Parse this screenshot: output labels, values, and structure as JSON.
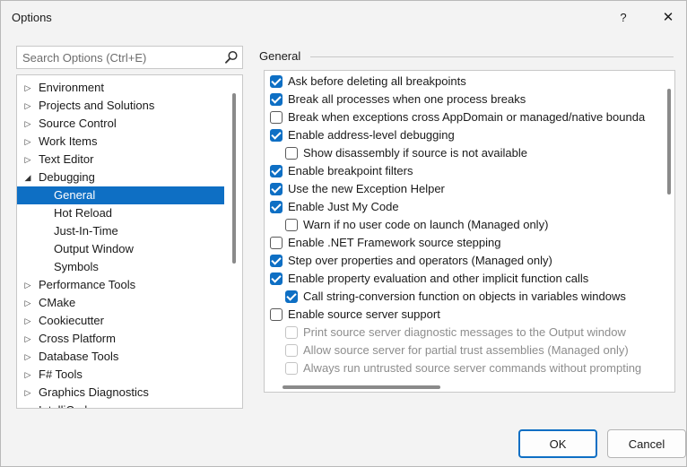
{
  "window": {
    "title": "Options",
    "help_glyph": "?",
    "close_glyph": "✕"
  },
  "search": {
    "placeholder": "Search Options (Ctrl+E)",
    "icon": "search-icon"
  },
  "tree": {
    "items": [
      {
        "label": "Environment",
        "level": 0,
        "expanded": false
      },
      {
        "label": "Projects and Solutions",
        "level": 0,
        "expanded": false
      },
      {
        "label": "Source Control",
        "level": 0,
        "expanded": false
      },
      {
        "label": "Work Items",
        "level": 0,
        "expanded": false
      },
      {
        "label": "Text Editor",
        "level": 0,
        "expanded": false
      },
      {
        "label": "Debugging",
        "level": 0,
        "expanded": true
      },
      {
        "label": "General",
        "level": 1,
        "selected": true
      },
      {
        "label": "Hot Reload",
        "level": 1
      },
      {
        "label": "Just-In-Time",
        "level": 1
      },
      {
        "label": "Output Window",
        "level": 1
      },
      {
        "label": "Symbols",
        "level": 1
      },
      {
        "label": "Performance Tools",
        "level": 0,
        "expanded": false
      },
      {
        "label": "CMake",
        "level": 0,
        "expanded": false
      },
      {
        "label": "Cookiecutter",
        "level": 0,
        "expanded": false
      },
      {
        "label": "Cross Platform",
        "level": 0,
        "expanded": false
      },
      {
        "label": "Database Tools",
        "level": 0,
        "expanded": false
      },
      {
        "label": "F# Tools",
        "level": 0,
        "expanded": false
      },
      {
        "label": "Graphics Diagnostics",
        "level": 0,
        "expanded": false
      },
      {
        "label": "IntelliCode",
        "level": 0,
        "expanded": false
      }
    ]
  },
  "group": {
    "title": "General"
  },
  "options": [
    {
      "label": "Ask before deleting all breakpoints",
      "checked": true,
      "indent": 0
    },
    {
      "label": "Break all processes when one process breaks",
      "checked": true,
      "indent": 0
    },
    {
      "label": "Break when exceptions cross AppDomain or managed/native bounda",
      "checked": false,
      "indent": 0
    },
    {
      "label": "Enable address-level debugging",
      "checked": true,
      "indent": 0
    },
    {
      "label": "Show disassembly if source is not available",
      "checked": false,
      "indent": 1
    },
    {
      "label": "Enable breakpoint filters",
      "checked": true,
      "indent": 0
    },
    {
      "label": "Use the new Exception Helper",
      "checked": true,
      "indent": 0
    },
    {
      "label": "Enable Just My Code",
      "checked": true,
      "indent": 0
    },
    {
      "label": "Warn if no user code on launch (Managed only)",
      "checked": false,
      "indent": 1
    },
    {
      "label": "Enable .NET Framework source stepping",
      "checked": false,
      "indent": 0
    },
    {
      "label": "Step over properties and operators (Managed only)",
      "checked": true,
      "indent": 0
    },
    {
      "label": "Enable property evaluation and other implicit function calls",
      "checked": true,
      "indent": 0
    },
    {
      "label": "Call string-conversion function on objects in variables windows",
      "checked": true,
      "indent": 1
    },
    {
      "label": "Enable source server support",
      "checked": false,
      "indent": 0
    },
    {
      "label": "Print source server diagnostic messages to the Output window",
      "checked": false,
      "indent": 1,
      "disabled": true
    },
    {
      "label": "Allow source server for partial trust assemblies (Managed only)",
      "checked": false,
      "indent": 1,
      "disabled": true
    },
    {
      "label": "Always run untrusted source server commands without prompting",
      "checked": false,
      "indent": 1,
      "disabled": true
    }
  ],
  "buttons": {
    "ok": "OK",
    "cancel": "Cancel"
  },
  "colors": {
    "accent": "#0e6fc4"
  }
}
